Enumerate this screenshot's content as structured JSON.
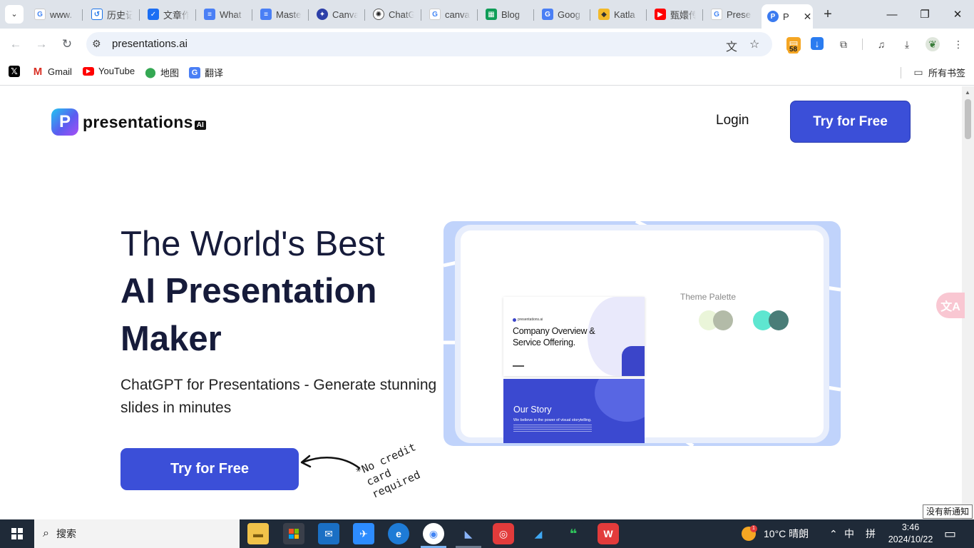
{
  "browser": {
    "tabs": [
      {
        "title": "www.",
        "icon": "google-icon"
      },
      {
        "title": "历史记",
        "icon": "history-icon"
      },
      {
        "title": "文章作",
        "icon": "doc-icon"
      },
      {
        "title": "What",
        "icon": "docs-icon"
      },
      {
        "title": "Maste",
        "icon": "docs-icon"
      },
      {
        "title": "Canva",
        "icon": "canva-icon"
      },
      {
        "title": "ChatG",
        "icon": "chatgpt-icon"
      },
      {
        "title": "canva",
        "icon": "google-icon"
      },
      {
        "title": "Blog",
        "icon": "sheets-icon"
      },
      {
        "title": "Goog",
        "icon": "translate-icon"
      },
      {
        "title": "Katla",
        "icon": "katla-icon"
      },
      {
        "title": "甄嬛传",
        "icon": "youtube-icon"
      },
      {
        "title": "Prese",
        "icon": "google-icon"
      }
    ],
    "active_tab": {
      "title": "P",
      "icon": "presentations-icon"
    },
    "url": "presentations.ai",
    "extension_badge": "58",
    "bookmarks": [
      {
        "label": "",
        "icon": "x-icon"
      },
      {
        "label": "Gmail",
        "icon": "gmail-icon"
      },
      {
        "label": "YouTube",
        "icon": "youtube-icon"
      },
      {
        "label": "地图",
        "icon": "maps-icon"
      },
      {
        "label": "翻译",
        "icon": "translate-icon"
      }
    ],
    "all_bookmarks": "所有书签"
  },
  "site": {
    "logo_text": "presentations",
    "logo_suffix": "AI",
    "login": "Login",
    "try_top": "Try for Free",
    "headline_line1": "The World's Best",
    "headline_line2": "AI Presentation",
    "headline_line3": "Maker",
    "subheading": "ChatGPT for Presentations - Generate stunning slides in minutes",
    "cta": "Try for Free",
    "no_credit_line1": "*No credit",
    "no_credit_line2": "card required",
    "hero": {
      "slide1_title": "Company Overview & Service Offering.",
      "slide2_title": "Our Story",
      "slide2_sub": "We believe in the power of visual storytelling.",
      "palette_label": "Theme Palette",
      "swatches": [
        "#eaf5d9",
        "#b3bba8",
        "#5ee6d0",
        "#4a7d78"
      ]
    }
  },
  "notification_tip": "没有新通知",
  "taskbar": {
    "search_placeholder": "搜索",
    "weather": "10°C  晴朗",
    "weather_badge": "1",
    "ime_lang": "中",
    "ime_mode": "拼",
    "time": "3:46",
    "date": "2024/10/22"
  },
  "colors": {
    "brand": "#3b4fd8",
    "headline": "#161b3a",
    "hero_bg": "#c0d3fb"
  }
}
